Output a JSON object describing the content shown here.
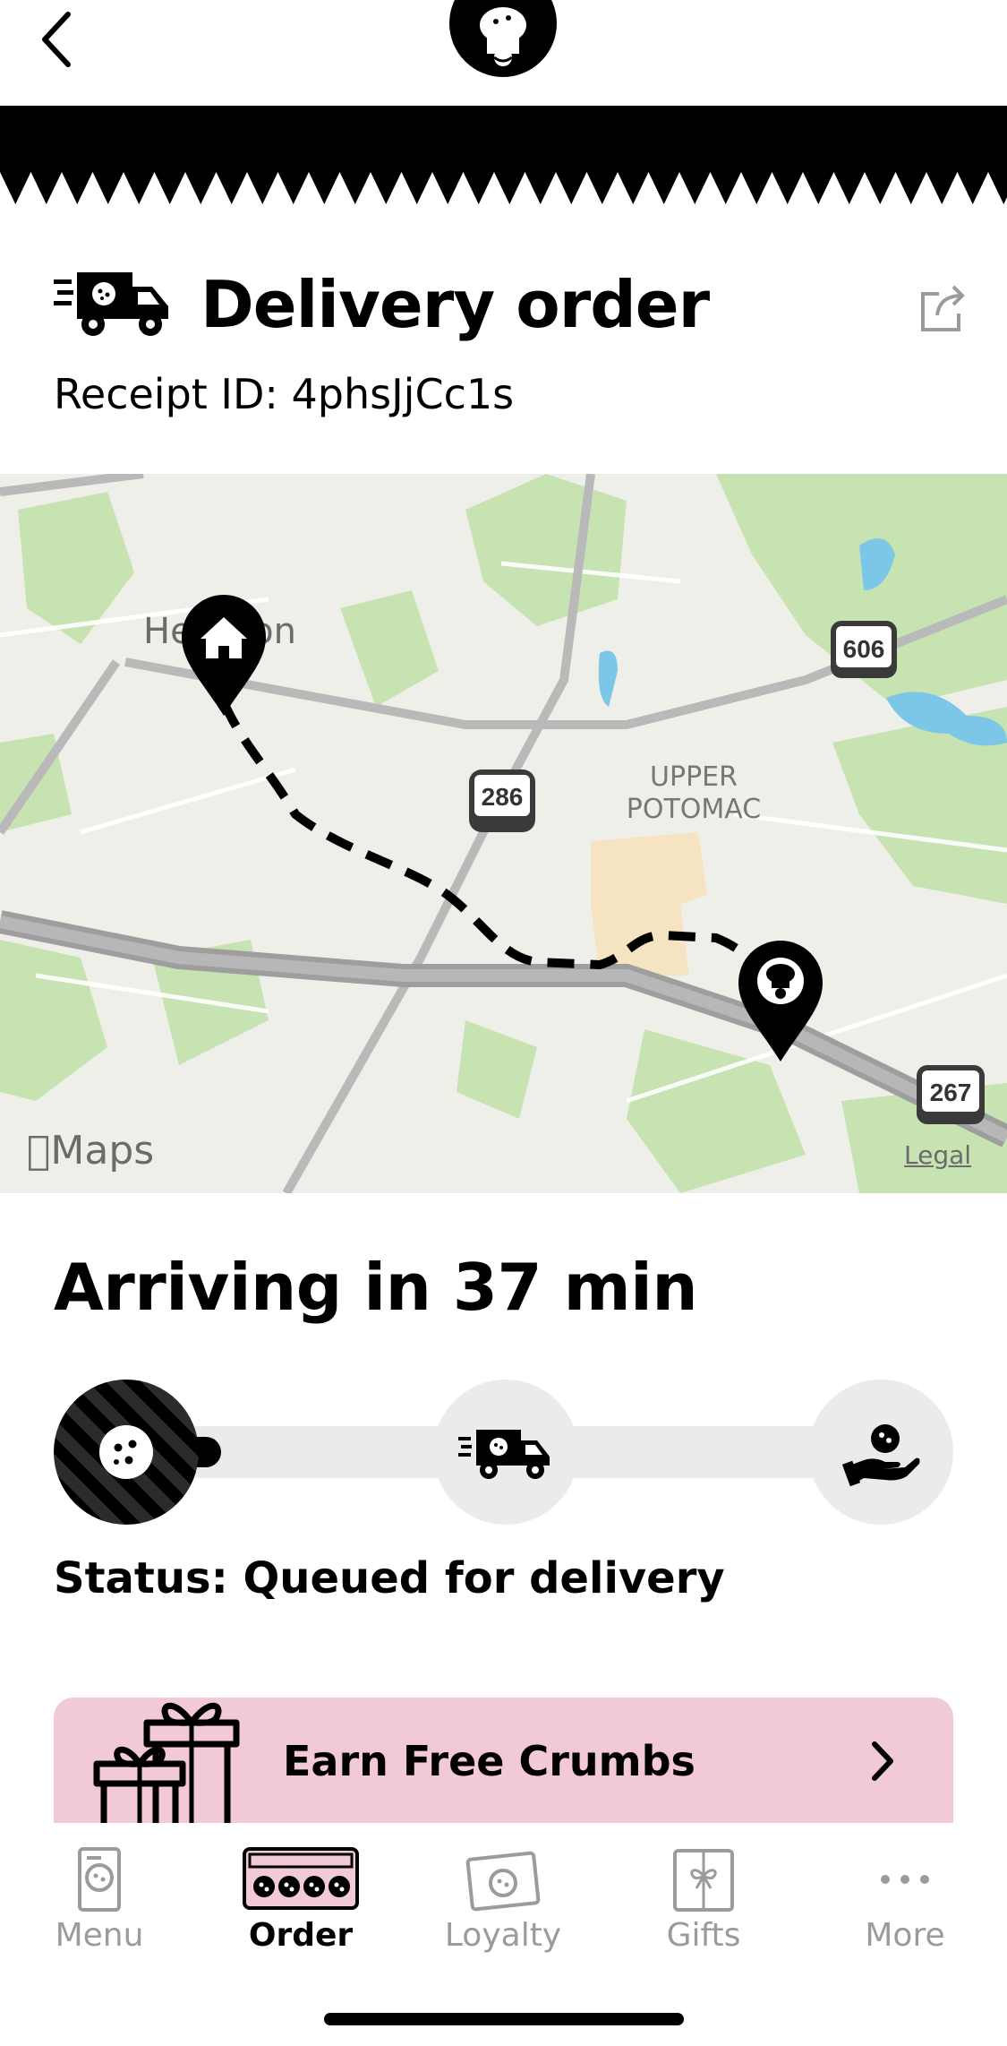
{
  "header": {
    "back_icon": "chevron-left-icon",
    "logo": "chef-cookie-logo"
  },
  "order": {
    "title": "Delivery order",
    "receipt": "Receipt ID: 4phsJjCc1s",
    "title_icon": "delivery-truck-icon",
    "share_icon": "share-icon"
  },
  "map": {
    "place_label": "Herndon",
    "area_label_line1": "UPPER",
    "area_label_line2": "POTOMAC",
    "shields": [
      "606",
      "286",
      "267"
    ],
    "brand": "Maps",
    "legal": "Legal",
    "home_pin_icon": "home-pin-icon",
    "store_pin_icon": "store-pin-icon"
  },
  "delivery": {
    "arriving": "Arriving in 37 min",
    "status": "Status: Queued for delivery",
    "progress": 0.02,
    "steps": [
      "cookie-icon",
      "delivery-truck-icon",
      "hand-receive-icon"
    ]
  },
  "promo": {
    "label": "Earn Free Crumbs",
    "icon": "gift-icon",
    "chevron": "chevron-right-icon"
  },
  "tabs": [
    {
      "label": "Menu",
      "icon": "menu-icon",
      "active": false
    },
    {
      "label": "Order",
      "icon": "order-box-icon",
      "active": true
    },
    {
      "label": "Loyalty",
      "icon": "loyalty-icon",
      "active": false
    },
    {
      "label": "Gifts",
      "icon": "gift-card-icon",
      "active": false
    },
    {
      "label": "More",
      "icon": "more-icon",
      "active": false
    }
  ],
  "colors": {
    "promo_bg": "#f2c9d6",
    "progress_track": "#ebebeb",
    "map_bg": "#efefe9",
    "map_green": "#c6e3b1",
    "map_water": "#7cc6e8",
    "inactive_tab": "#9b9b9b"
  }
}
